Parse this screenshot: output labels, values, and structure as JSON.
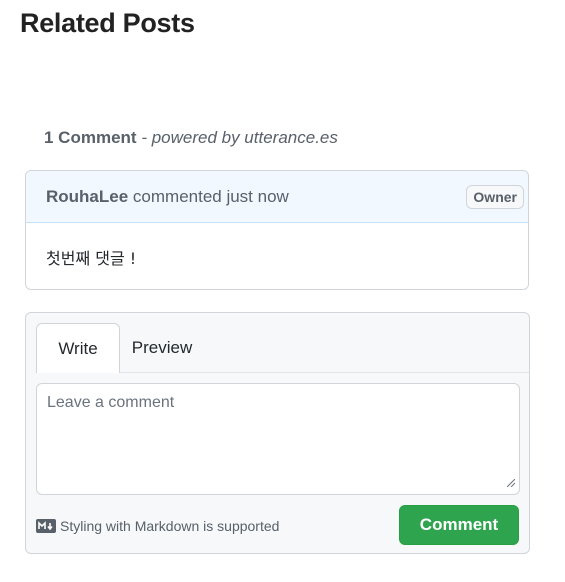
{
  "page": {
    "related_title": "Related Posts"
  },
  "comments_section": {
    "count_label": "1 Comment",
    "powered_by": "- powered by utterance.es"
  },
  "comment": {
    "author": "RouhaLee",
    "meta": " commented just now",
    "badge": "Owner",
    "body": "첫번째 댓글 !"
  },
  "editor": {
    "tabs": [
      "Write",
      "Preview"
    ],
    "active_tab": "Write",
    "placeholder": "Leave a comment",
    "markdown_note": "Styling with Markdown is supported",
    "submit_label": "Comment"
  },
  "colors": {
    "accent_green": "#2ea44f",
    "header_blue": "#f1f8ff",
    "border": "#d1d5da"
  }
}
